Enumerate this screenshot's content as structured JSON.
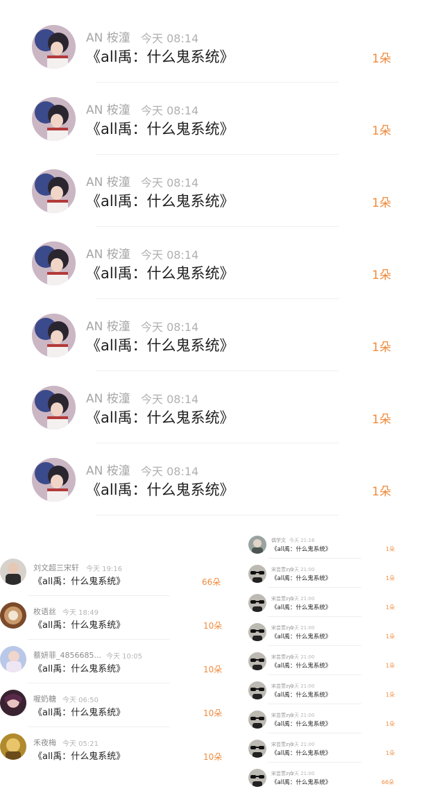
{
  "top_list": {
    "items": [
      {
        "name": "AN 桉潼",
        "time": "今天 08:14",
        "title": "《all禹：什么鬼系统》",
        "count": "1朵"
      },
      {
        "name": "AN 桉潼",
        "time": "今天 08:14",
        "title": "《all禹：什么鬼系统》",
        "count": "1朵"
      },
      {
        "name": "AN 桉潼",
        "time": "今天 08:14",
        "title": "《all禹：什么鬼系统》",
        "count": "1朵"
      },
      {
        "name": "AN 桉潼",
        "time": "今天 08:14",
        "title": "《all禹：什么鬼系统》",
        "count": "1朵"
      },
      {
        "name": "AN 桉潼",
        "time": "今天 08:14",
        "title": "《all禹：什么鬼系统》",
        "count": "1朵"
      },
      {
        "name": "AN 桉潼",
        "time": "今天 08:14",
        "title": "《all禹：什么鬼系统》",
        "count": "1朵"
      },
      {
        "name": "AN 桉潼",
        "time": "今天 08:14",
        "title": "《all禹：什么鬼系统》",
        "count": "1朵"
      }
    ]
  },
  "left_list": {
    "items": [
      {
        "name": "刘文超三宋轩",
        "time": "今天 19:16",
        "title": "《all禹：什么鬼系统》",
        "count": "66朵"
      },
      {
        "name": "枚语丝",
        "time": "今天 18:49",
        "title": "《all禹：什么鬼系统》",
        "count": "10朵"
      },
      {
        "name": "蔡妍菲_4856685...",
        "time": "今天 10:05",
        "title": "《all禹：什么鬼系统》",
        "count": "10朵"
      },
      {
        "name": "喔奶糖",
        "time": "今天 06:50",
        "title": "《all禹：什么鬼系统》",
        "count": "10朵"
      },
      {
        "name": "禾夜梅",
        "time": "今天 05:21",
        "title": "《all禹：什么鬼系统》",
        "count": "10朵"
      }
    ]
  },
  "right_list": {
    "items": [
      {
        "name": "偶学文",
        "time": "今天 21:16",
        "title": "《all禹：什么鬼系统》",
        "count": "1朵"
      },
      {
        "name": "宋芸萱zyz",
        "time": "今天 21:00",
        "title": "《all禹：什么鬼系统》",
        "count": "1朵"
      },
      {
        "name": "宋芸萱zyz",
        "time": "今天 21:00",
        "title": "《all禹：什么鬼系统》",
        "count": "1朵"
      },
      {
        "name": "宋芸萱zyz",
        "time": "今天 21:00",
        "title": "《all禹：什么鬼系统》",
        "count": "1朵"
      },
      {
        "name": "宋芸萱zyz",
        "time": "今天 21:00",
        "title": "《all禹：什么鬼系统》",
        "count": "1朵"
      },
      {
        "name": "宋芸萱zyz",
        "time": "今天 21:00",
        "title": "《all禹：什么鬼系统》",
        "count": "1朵"
      },
      {
        "name": "宋芸萱zyz",
        "time": "今天 21:00",
        "title": "《all禹：什么鬼系统》",
        "count": "1朵"
      },
      {
        "name": "宋芸萱zyz",
        "time": "今天 21:00",
        "title": "《all禹：什么鬼系统》",
        "count": "1朵"
      },
      {
        "name": "宋芸萱zyz",
        "time": "今天 21:00",
        "title": "《all禹：什么鬼系统》",
        "count": "66朵"
      }
    ]
  },
  "colors": {
    "accent": "#f08a3c",
    "text": "#1e1e1e",
    "meta": "#a6a6a6"
  }
}
